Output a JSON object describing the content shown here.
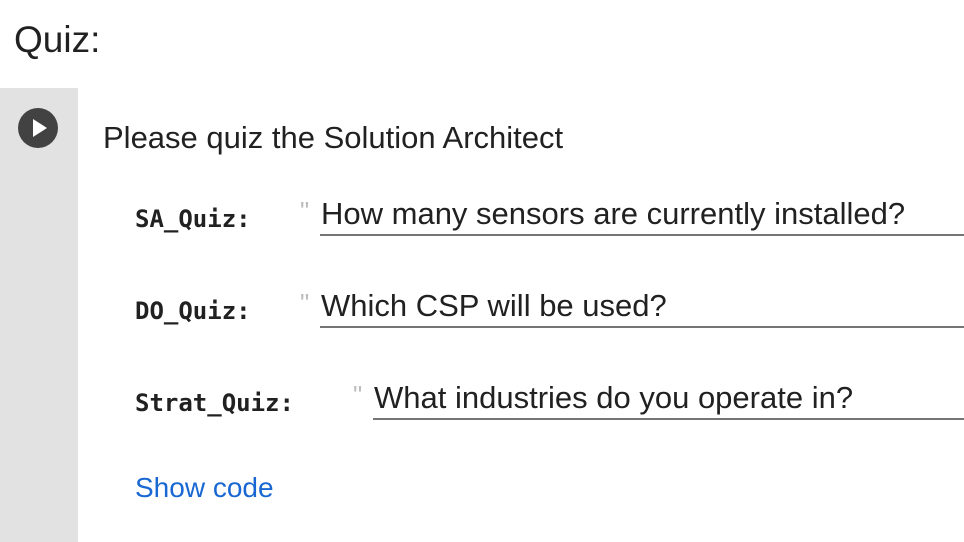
{
  "section": {
    "title": "Quiz:"
  },
  "cell": {
    "heading": "Please quiz the Solution Architect",
    "run_icon": "play-icon",
    "fields": [
      {
        "label": "SA_Quiz:",
        "quote": "\"",
        "value": "How many sensors are currently installed?"
      },
      {
        "label": "DO_Quiz:",
        "quote": "\"",
        "value": "Which CSP will be used?"
      },
      {
        "label": "Strat_Quiz:",
        "quote": "\"",
        "value": "What industries do you operate in?"
      }
    ],
    "show_code_label": "Show code"
  },
  "colors": {
    "gutter": "#e2e2e2",
    "run_button": "#424242",
    "link": "#1967d2",
    "underline": "#757575",
    "quote": "#bdbdbd"
  }
}
